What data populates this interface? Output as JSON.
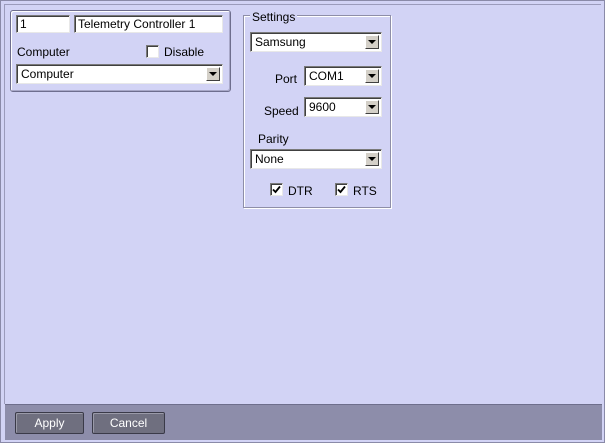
{
  "device": {
    "id": "1",
    "name": "Telemetry Controller 1",
    "computer_label": "Computer",
    "disable_label": "Disable",
    "disable_checked": false,
    "computer_value": "Computer"
  },
  "settings": {
    "title": "Settings",
    "protocol_value": "Samsung",
    "port_label": "Port",
    "port_value": "COM1",
    "speed_label": "Speed",
    "speed_value": "9600",
    "parity_label": "Parity",
    "parity_value": "None",
    "dtr_label": "DTR",
    "dtr_checked": true,
    "rts_label": "RTS",
    "rts_checked": true
  },
  "actions": {
    "apply_label": "Apply",
    "cancel_label": "Cancel"
  },
  "colors": {
    "background": "#d2d3f5",
    "bottom_bar": "#8d8daa",
    "button": "#6f6f7f"
  }
}
